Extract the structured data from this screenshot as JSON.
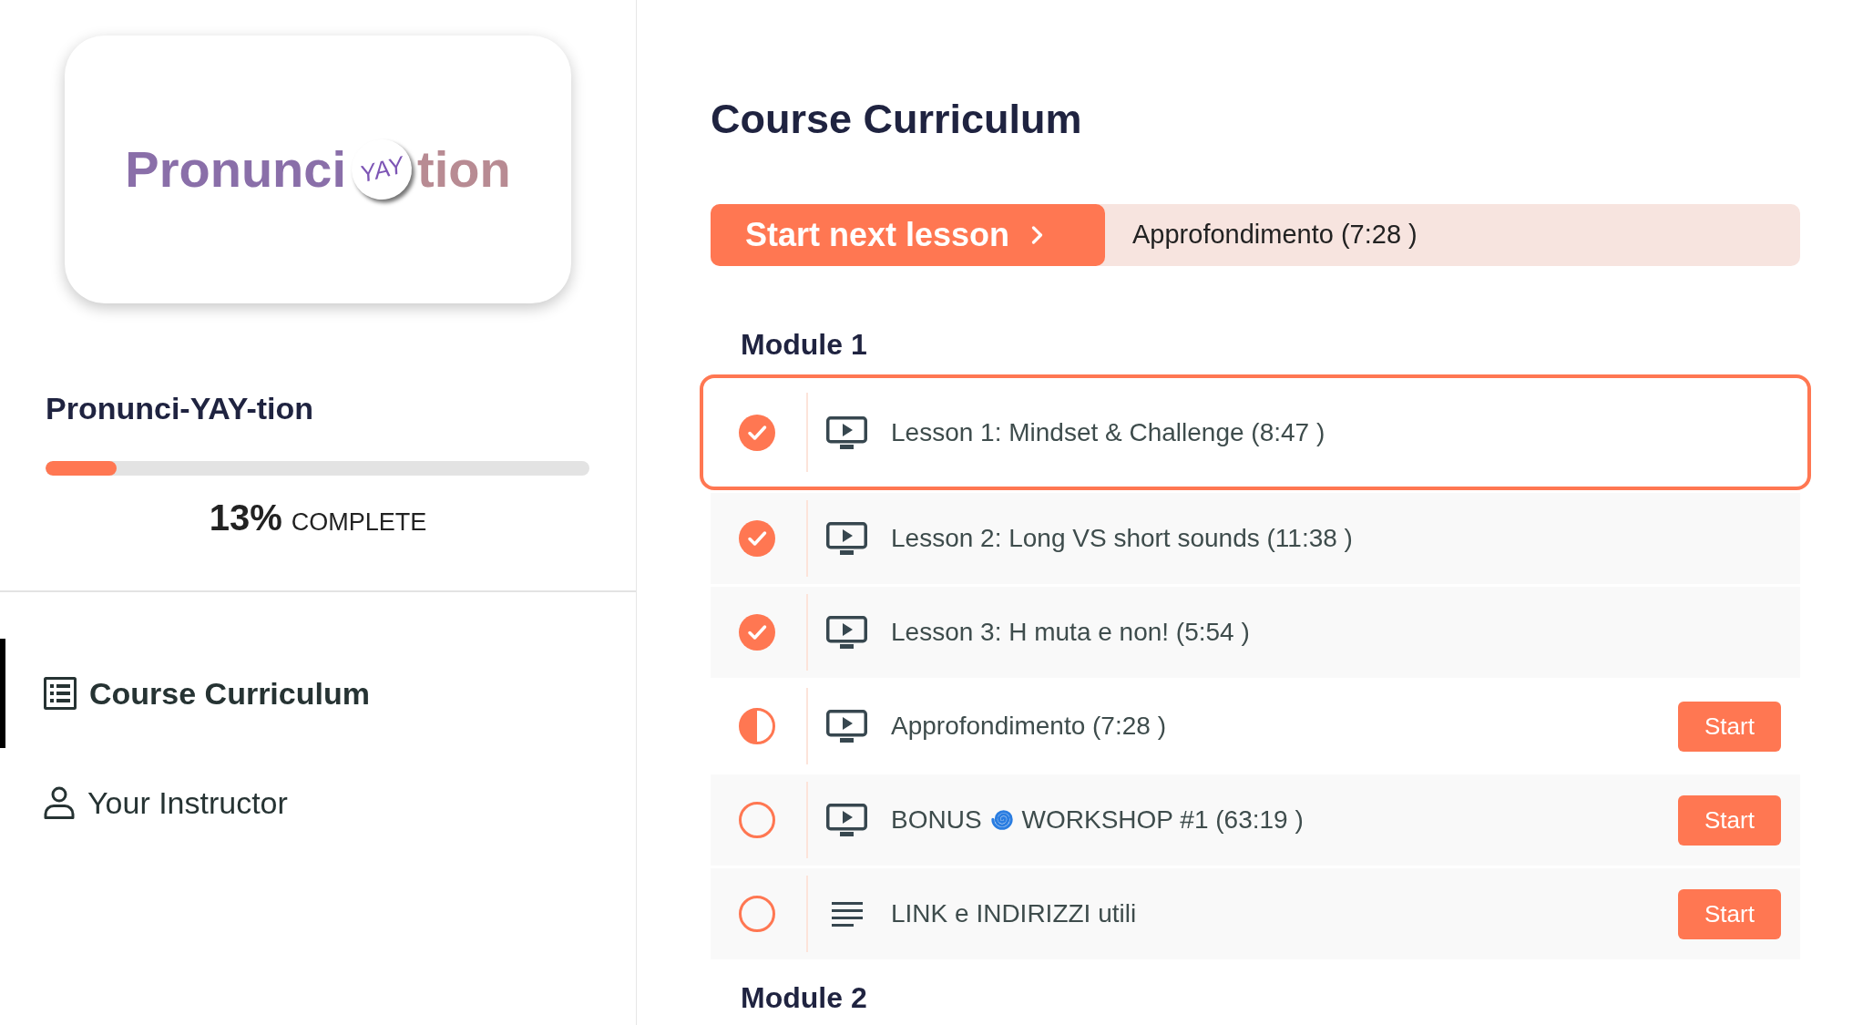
{
  "sidebar": {
    "logo": {
      "text_before": "Pronunci",
      "emblem": "YAY",
      "text_after": "tion"
    },
    "course_title": "Pronunci-YAY-tion",
    "progress": {
      "level": 0.13,
      "percent": "13%",
      "label": "COMPLETE"
    },
    "nav": [
      {
        "kind": "curriculum",
        "label": "Course Curriculum",
        "selected": true
      },
      {
        "kind": "instructor",
        "label": "Your Instructor",
        "selected": false
      }
    ]
  },
  "main": {
    "title": "Course Curriculum",
    "next_lesson": {
      "button": "Start next lesson",
      "lesson": "Approfondimento (7:28 )"
    },
    "modules": [
      {
        "title": "Module 1",
        "lessons": [
          {
            "kind": "video",
            "completed": true,
            "started": true,
            "selected": true,
            "title": "Lesson 1: Mindset & Challenge (8:47 )"
          },
          {
            "kind": "video",
            "completed": true,
            "started": true,
            "selected": false,
            "title": "Lesson 2: Long VS short sounds (11:38 )"
          },
          {
            "kind": "video",
            "completed": true,
            "started": true,
            "selected": false,
            "title": "Lesson 3: H muta e non! (5:54 )"
          },
          {
            "kind": "video",
            "completed": false,
            "started": true,
            "selected": false,
            "title": "Approfondimento (7:28 )",
            "action": "Start"
          },
          {
            "kind": "video",
            "completed": false,
            "started": false,
            "selected": false,
            "title": "BONUS",
            "title_after_icon": "WORKSHOP #1 (63:19 )",
            "action": "Start"
          },
          {
            "kind": "text",
            "completed": false,
            "started": false,
            "selected": false,
            "title": "LINK e INDIRIZZI utili",
            "action": "Start"
          }
        ]
      },
      {
        "title": "Module 2"
      }
    ]
  }
}
